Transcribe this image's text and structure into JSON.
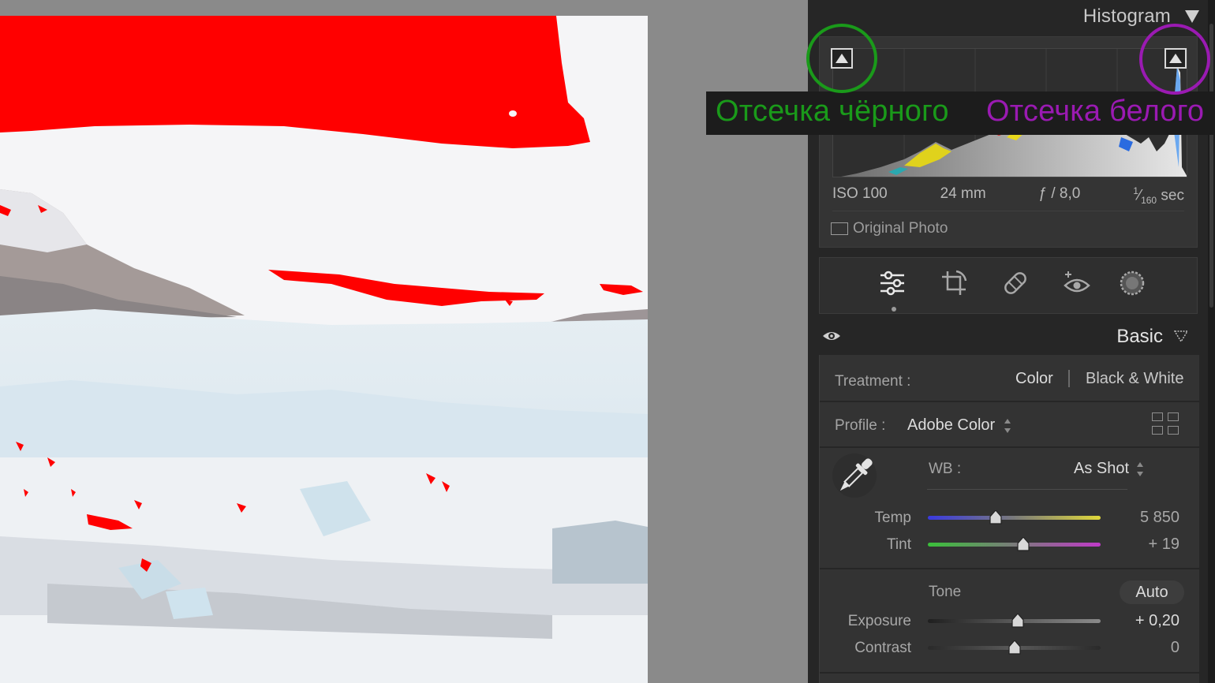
{
  "histogram": {
    "title": "Histogram",
    "meta": {
      "iso": "ISO 100",
      "focal": "24 mm",
      "aperture": "ƒ / 8,0",
      "shutter_num": "1",
      "shutter_den": "160",
      "shutter_unit": "sec"
    },
    "original_photo_label": "Original Photo"
  },
  "annotations": {
    "black_clip": "Отсечка чёрного",
    "white_clip": "Отсечка белого",
    "black_color": "#1a9a1a",
    "white_color": "#9a1ab2"
  },
  "basic": {
    "title": "Basic",
    "treatment_label": "Treatment :",
    "treatment_color": "Color",
    "treatment_bw": "Black & White",
    "profile_label": "Profile :",
    "profile_value": "Adobe Color",
    "wb_label": "WB :",
    "wb_value": "As Shot",
    "tone_label": "Tone",
    "auto_label": "Auto",
    "sliders": [
      {
        "label": "Temp",
        "value": "5 850",
        "position": 0.39
      },
      {
        "label": "Tint",
        "value": "+ 19",
        "position": 0.55
      },
      {
        "label": "Exposure",
        "value": "+ 0,20",
        "position": 0.52
      },
      {
        "label": "Contrast",
        "value": "0",
        "position": 0.5
      }
    ]
  },
  "colors": {
    "clipping_red": "#ff0000",
    "panel_bg": "#262626"
  }
}
